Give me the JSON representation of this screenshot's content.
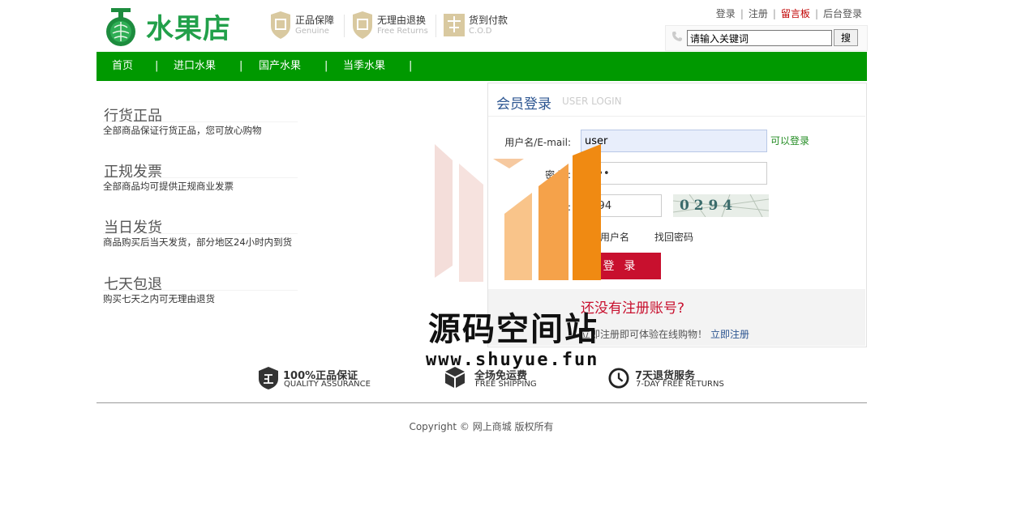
{
  "header": {
    "logo_text": "水果店",
    "features": [
      {
        "title": "正品保障",
        "sub": "Genuine",
        "icon": "genuine-seal-icon"
      },
      {
        "title": "无理由退换",
        "sub": "Free Returns",
        "icon": "returns-seal-icon"
      },
      {
        "title": "货到付款",
        "sub": "C.O.D",
        "icon": "cod-icon"
      }
    ],
    "top_links": [
      "登录",
      "注册",
      "留言板",
      "后台登录"
    ],
    "search": {
      "value": "请输入关键词",
      "button": "搜"
    }
  },
  "nav": {
    "items": [
      "首页",
      "进口水果",
      "国产水果",
      "当季水果"
    ],
    "separator": "|"
  },
  "left_features": [
    {
      "title": "行货正品",
      "desc": "全部商品保证行货正品，您可放心购物"
    },
    {
      "title": "正规发票",
      "desc": "全部商品均可提供正规商业发票"
    },
    {
      "title": "当日发货",
      "desc": "商品购买后当天发货，部分地区24小时内到货"
    },
    {
      "title": "七天包退",
      "desc": "购买七天之内可无理由退货"
    }
  ],
  "login": {
    "title": "会员登录",
    "subtitle": "USER LOGIN",
    "username_label": "用户名/E-mail:",
    "username_value": "user",
    "username_hint": "可以登录",
    "password_label": "密  码:",
    "password_value": "••••",
    "captcha_label": "验证码:",
    "captcha_value": "0294",
    "captcha_image_text": "0 2 9 4",
    "remember_label": "记住用户名",
    "forgot_label": "找回密码",
    "login_button": "登 录",
    "no_account": "还没有注册账号?",
    "register_tip": "立即注册即可体验在线购物！",
    "register_link": "立即注册"
  },
  "guarantees": [
    {
      "title": "100%正品保证",
      "sub": "QUALITY ASSURANCE",
      "icon": "genuine-shield-icon"
    },
    {
      "title": "全场免运费",
      "sub": "FREE SHIPPING",
      "icon": "box-icon"
    },
    {
      "title": "7天退货服务",
      "sub": "7-DAY FREE RETURNS",
      "icon": "clock-icon"
    }
  ],
  "footer": {
    "copyright": "Copyright © 网上商城 版权所有"
  },
  "watermark": {
    "text": "源码空间站",
    "url": "www.shuyue.fun"
  },
  "colors": {
    "brand_green": "#009900",
    "logo_green": "#22a04a",
    "login_red": "#c8102e",
    "link_blue": "#2c5591"
  }
}
